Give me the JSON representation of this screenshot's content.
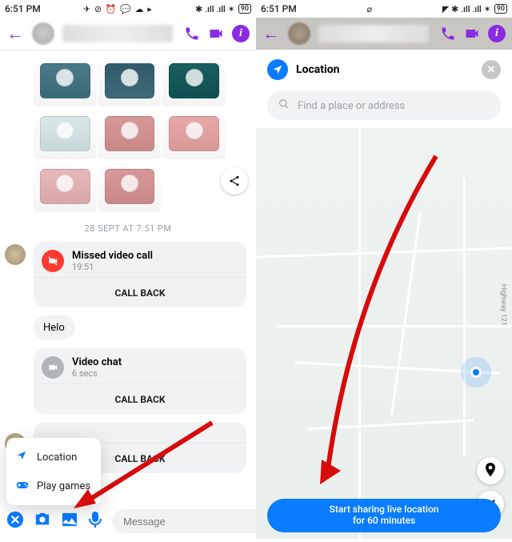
{
  "status": {
    "time": "6:51 PM",
    "battery": "90"
  },
  "left": {
    "timestamp": "28 SEPT AT 7:51 PM",
    "missed": {
      "title": "Missed video call",
      "time": "19:51"
    },
    "callback": "CALL BACK",
    "helo": "Helo",
    "video": {
      "title": "Video chat",
      "sub": "6 secs"
    },
    "popup": {
      "location": "Location",
      "games": "Play games"
    },
    "composer": {
      "placeholder": "Message"
    }
  },
  "right": {
    "title": "Location",
    "search_placeholder": "Find a place or address",
    "highway": "Highway 121",
    "share_line1": "Start sharing live location",
    "share_line2": "for 60 minutes"
  }
}
